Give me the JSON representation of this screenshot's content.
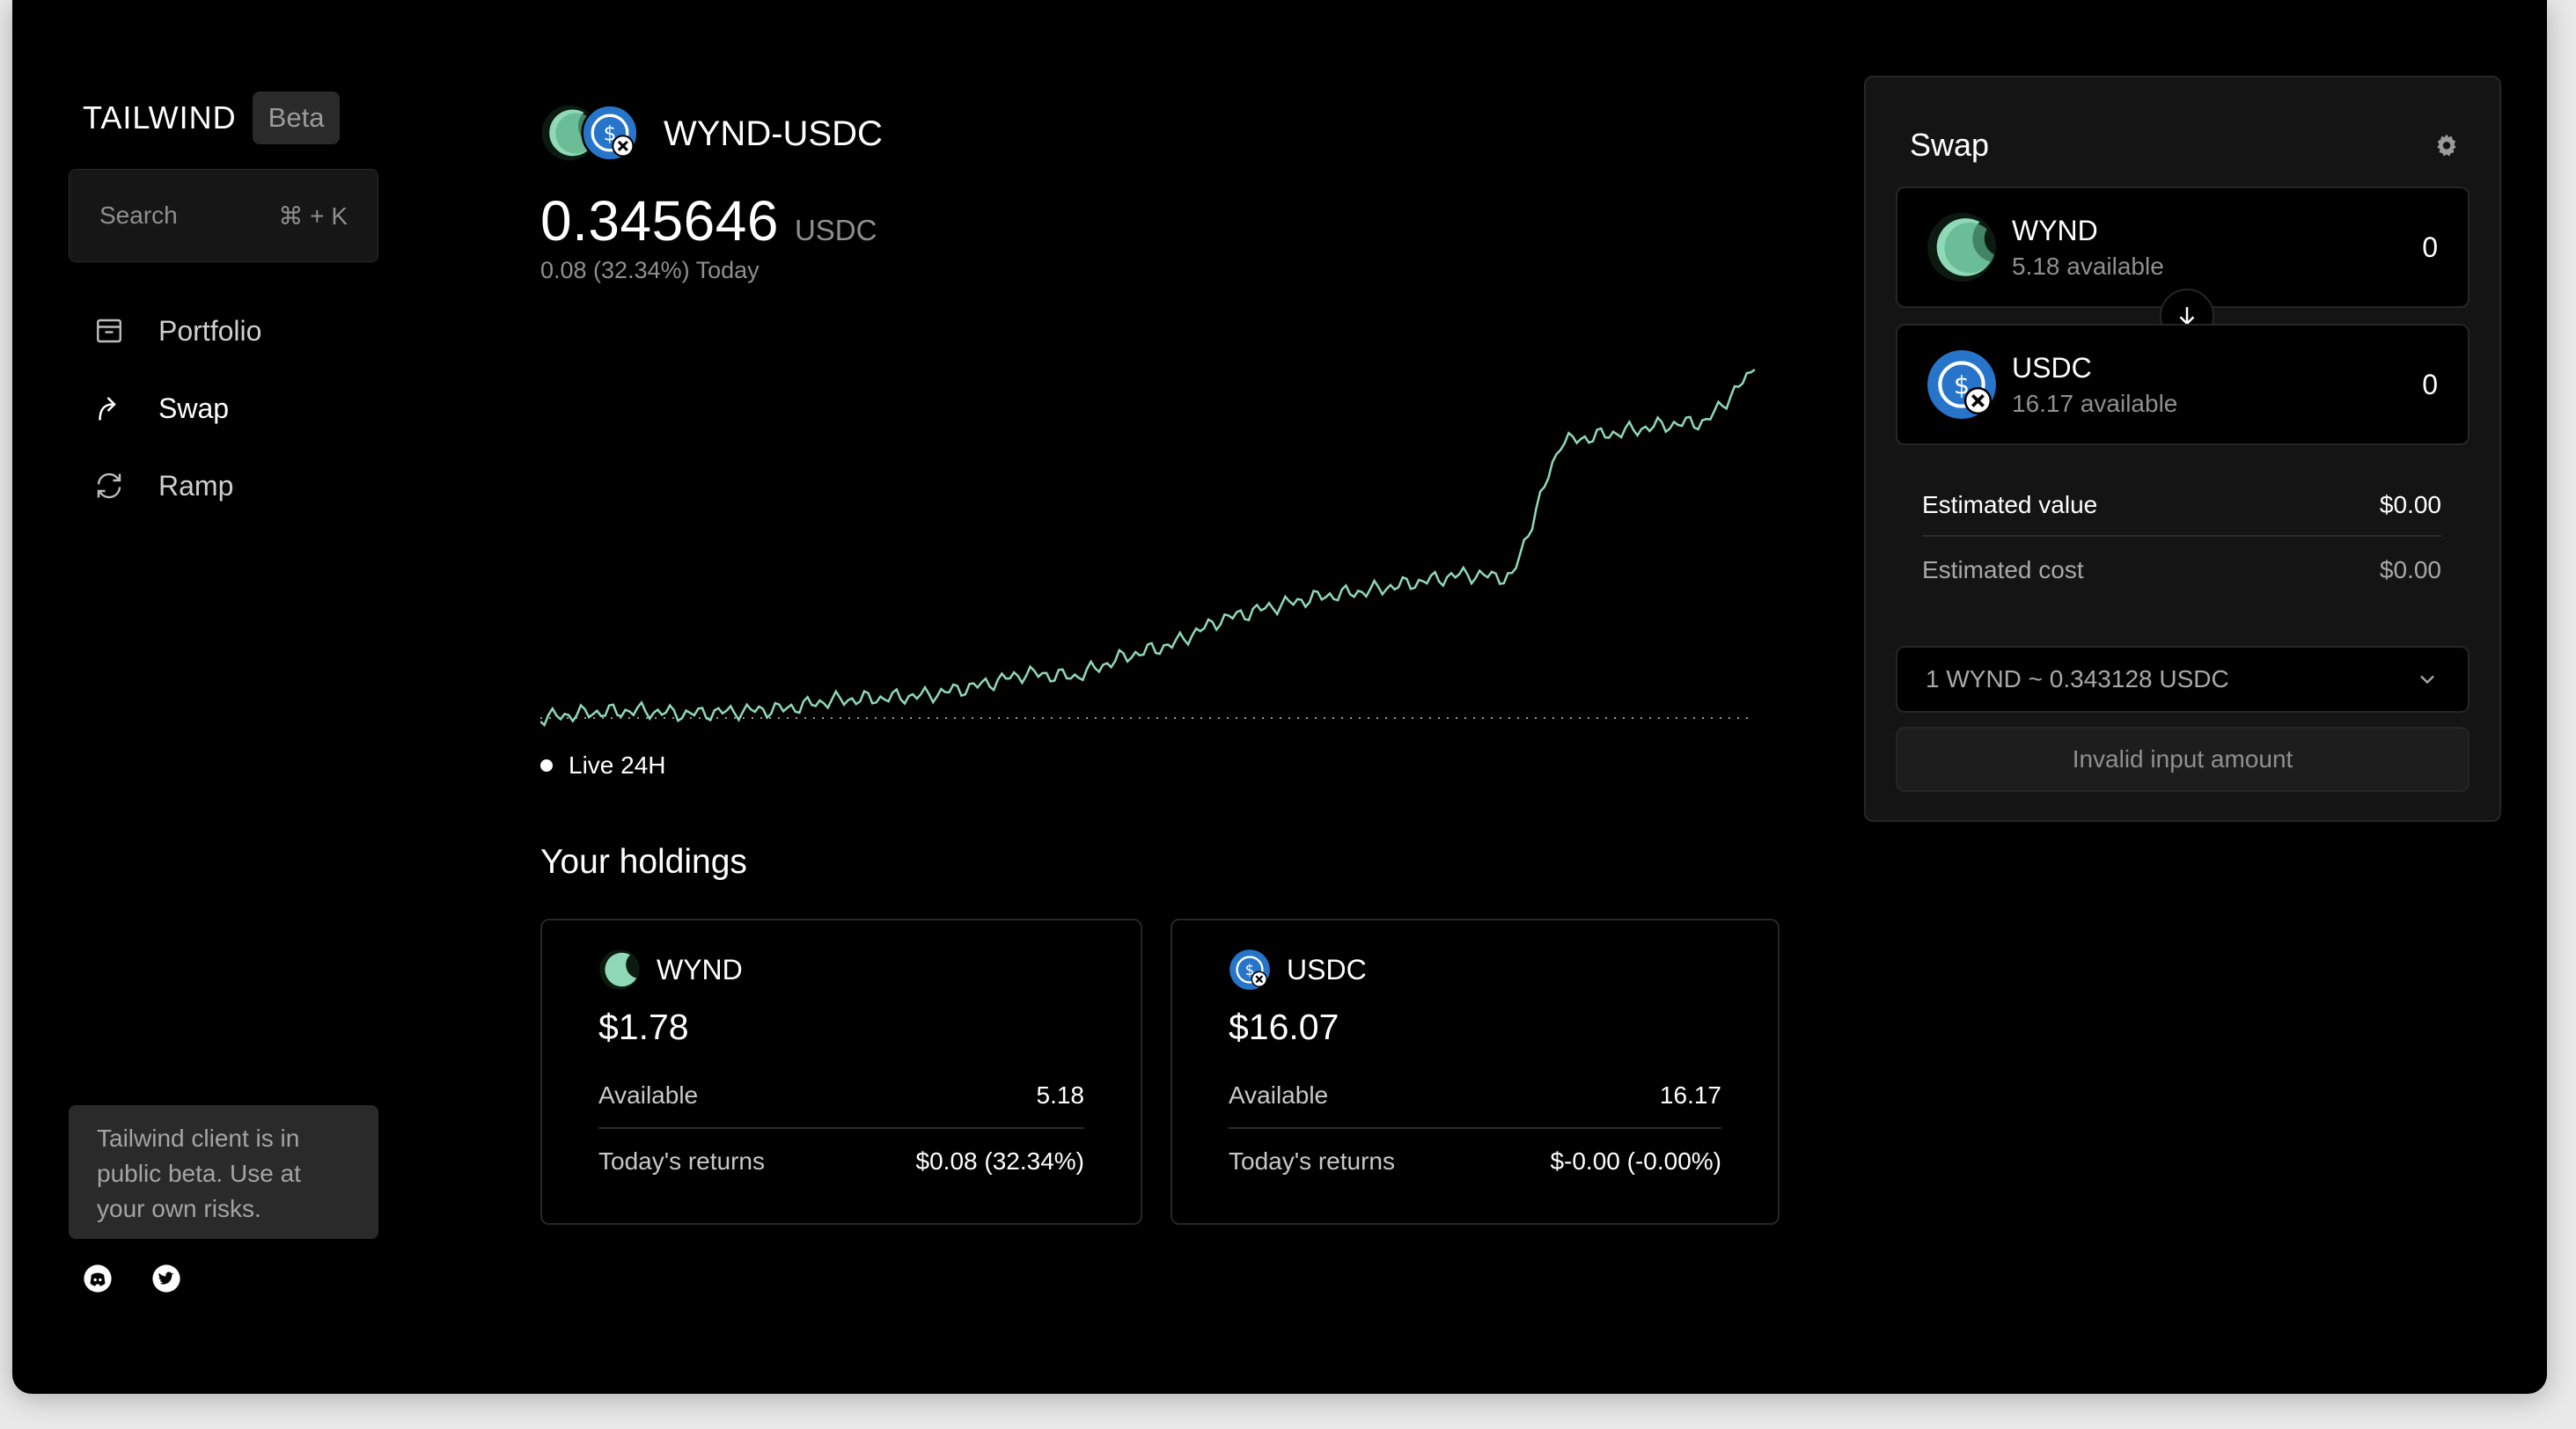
{
  "sidebar": {
    "logo": "TAILWIND",
    "badge": "Beta",
    "search": {
      "placeholder": "Search",
      "shortcut": "⌘ + K"
    },
    "nav": [
      {
        "label": "Portfolio",
        "icon": "archive-icon"
      },
      {
        "label": "Swap",
        "icon": "swap-arrow-icon",
        "active": true
      },
      {
        "label": "Ramp",
        "icon": "refresh-icon"
      }
    ],
    "beta_note": "Tailwind client is in public beta. Use at your own risks.",
    "socials": [
      "discord-icon",
      "twitter-icon"
    ]
  },
  "market": {
    "pair": "WYND-USDC",
    "price": "0.345646",
    "unit": "USDC",
    "change": "0.08 (32.34%) Today",
    "range_label": "Live 24H"
  },
  "chart_data": {
    "type": "line",
    "title": "",
    "xlabel": "",
    "ylabel": "",
    "range": "Live 24H",
    "grid": false,
    "baseline": "dotted",
    "color": "#8fd9b6",
    "x": [
      0,
      4,
      8,
      12,
      16,
      20,
      24,
      28,
      32,
      36,
      40,
      44,
      48,
      52,
      56,
      60,
      64,
      68,
      72,
      76,
      80,
      84,
      88,
      92,
      96,
      100
    ],
    "values": [
      0.2612,
      0.2625,
      0.263,
      0.2622,
      0.2628,
      0.2634,
      0.2655,
      0.266,
      0.2668,
      0.269,
      0.272,
      0.2712,
      0.276,
      0.279,
      0.285,
      0.288,
      0.2905,
      0.292,
      0.294,
      0.296,
      0.2952,
      0.328,
      0.33,
      0.332,
      0.333,
      0.3456
    ]
  },
  "holdings": {
    "title": "Your holdings",
    "cards": [
      {
        "symbol": "WYND",
        "value": "$1.78",
        "available_label": "Available",
        "available": "5.18",
        "returns_label": "Today's returns",
        "returns": "$0.08 (32.34%)"
      },
      {
        "symbol": "USDC",
        "value": "$16.07",
        "available_label": "Available",
        "available": "16.17",
        "returns_label": "Today's returns",
        "returns": "$-0.00 (-0.00%)"
      }
    ]
  },
  "swap": {
    "title": "Swap",
    "from": {
      "symbol": "WYND",
      "available": "5.18 available",
      "amount": "0"
    },
    "to": {
      "symbol": "USDC",
      "available": "16.17 available",
      "amount": "0"
    },
    "estimated_value_label": "Estimated value",
    "estimated_value": "$0.00",
    "estimated_cost_label": "Estimated cost",
    "estimated_cost": "$0.00",
    "rate": "1 WYND ~ 0.343128 USDC",
    "submit": "Invalid input amount"
  },
  "colors": {
    "accent": "#8fd9b6",
    "wynd": "#7fd3a4",
    "usdc": "#2775ca",
    "background": "#000000",
    "panel": "#141414"
  }
}
